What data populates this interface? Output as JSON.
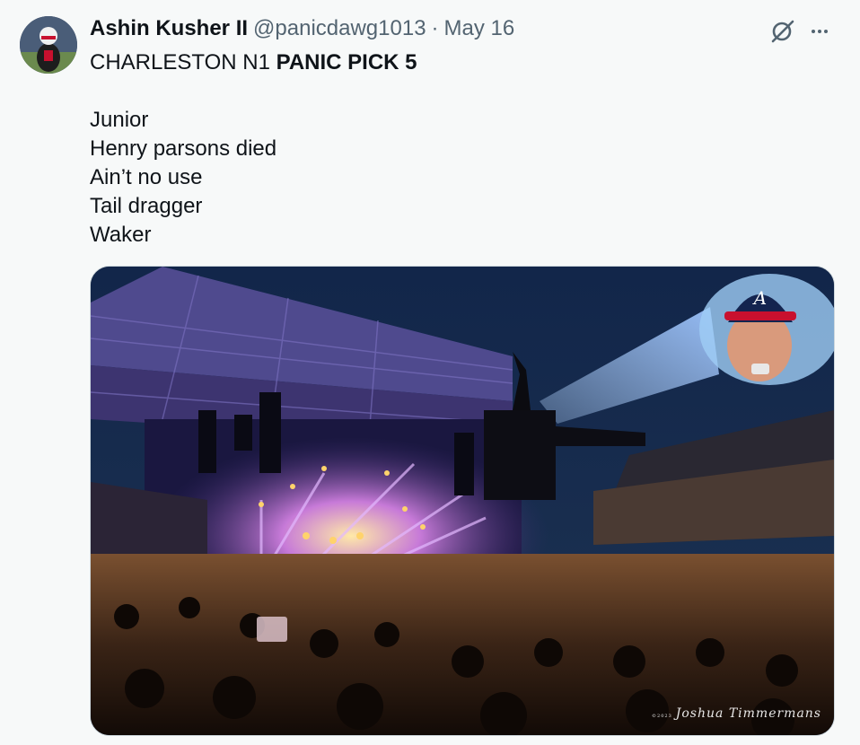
{
  "tweet": {
    "author_name": "Ashin Kusher II",
    "handle": "@panicdawg1013",
    "separator": "·",
    "date": "May 16",
    "line1_normal": "CHARLESTON N1 ",
    "line1_bold": "PANIC PICK 5",
    "lines": [
      "Junior",
      "Henry parsons died",
      "Ain’t no use",
      "Tail dragger",
      "Waker"
    ]
  },
  "media": {
    "watermark_small": "©2023",
    "watermark": "Joshua Timmermans",
    "cap_letter": "A"
  },
  "icons": {
    "avatar": "avatar",
    "grok": "grok-icon",
    "more": "more-icon"
  }
}
